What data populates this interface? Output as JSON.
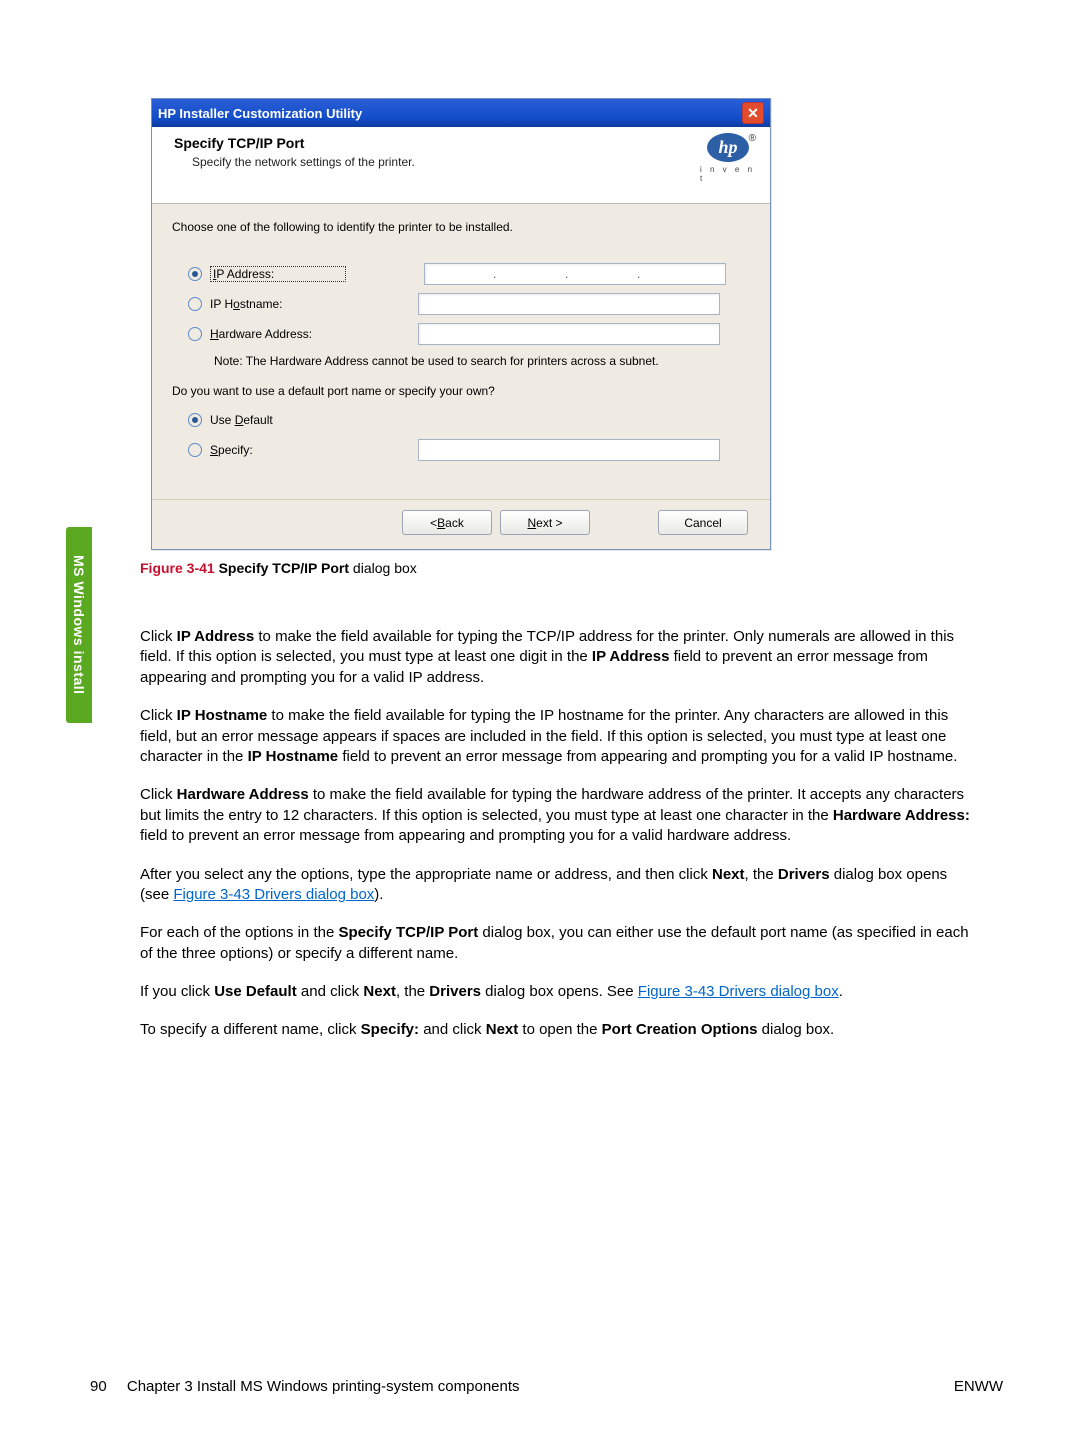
{
  "side_tab": "MS Windows install",
  "dialog": {
    "title": "HP Installer Customization Utility",
    "header_title": "Specify TCP/IP Port",
    "header_sub": "Specify the network settings of the printer.",
    "logo_text": "hp",
    "logo_invent": "i n v e n t",
    "logo_reg": "®",
    "instruction": "Choose one of the following to identify the printer to be installed.",
    "radio_ip_address_pre": "I",
    "radio_ip_address_rest": "P Address:",
    "radio_ip_hostname_pre": "IP H",
    "radio_ip_hostname_rest": "ostname:",
    "radio_ip_hostname_u": "o",
    "radio_hw_pre": "H",
    "radio_hw_rest": "ardware Address:",
    "note": "Note: The Hardware Address cannot be used to search for printers across a subnet.",
    "q2": "Do you want to use a default port name or specify your own?",
    "radio_default_pre": "Use ",
    "radio_default_u": "D",
    "radio_default_rest": "efault",
    "radio_specify_u": "S",
    "radio_specify_rest": "pecify:",
    "btn_back_pre": "< ",
    "btn_back_u": "B",
    "btn_back_rest": "ack",
    "btn_next_u": "N",
    "btn_next_rest": "ext >",
    "btn_cancel": "Cancel"
  },
  "caption": {
    "fig": "Figure 3-41",
    "bold": "  Specify TCP/IP Port",
    "rest": " dialog box"
  },
  "paragraphs": {
    "p1a": "Click ",
    "p1b": "IP Address",
    "p1c": " to make the field available for typing the TCP/IP address for the printer. Only numerals are allowed in this field. If this option is selected, you must type at least one digit in the ",
    "p1d": "IP Address",
    "p1e": " field to prevent an error message from appearing and prompting you for a valid IP address.",
    "p2a": "Click ",
    "p2b": "IP Hostname",
    "p2c": " to make the field available for typing the IP hostname for the printer. Any characters are allowed in this field, but an error message appears if spaces are included in the field. If this option is selected, you must type at least one character in the ",
    "p2d": "IP Hostname",
    "p2e": " field to prevent an error message from appearing and prompting you for a valid IP hostname.",
    "p3a": "Click ",
    "p3b": "Hardware Address",
    "p3c": " to make the field available for typing the hardware address of the printer. It accepts any characters but limits the entry to 12 characters. If this option is selected, you must type at least one character in the ",
    "p3d": "Hardware Address:",
    "p3e": " field to prevent an error message from appearing and prompting you for a valid hardware address.",
    "p4a": "After you select any the options, type the appropriate name or address, and then click ",
    "p4b": "Next",
    "p4c": ", the ",
    "p4d": "Drivers",
    "p4e": " dialog box opens (see ",
    "p4link": "Figure 3-43 Drivers dialog box",
    "p4f": ").",
    "p5a": "For each of the options in the ",
    "p5b": "Specify TCP/IP Port",
    "p5c": " dialog box, you can either use the default port name (as specified in each of the three options) or specify a different name.",
    "p6a": "If you click ",
    "p6b": "Use Default",
    "p6c": " and click ",
    "p6d": "Next",
    "p6e": ", the ",
    "p6f": "Drivers",
    "p6g": " dialog box opens. See ",
    "p6link": "Figure 3-43 Drivers dialog box",
    "p6h": ".",
    "p7a": "To specify a different name, click ",
    "p7b": "Specify:",
    "p7c": " and click ",
    "p7d": "Next",
    "p7e": " to open the ",
    "p7f": "Port Creation Options",
    "p7g": " dialog box."
  },
  "footer": {
    "page": "90",
    "chapter": "Chapter 3   Install MS Windows printing-system components",
    "right": "ENWW"
  }
}
